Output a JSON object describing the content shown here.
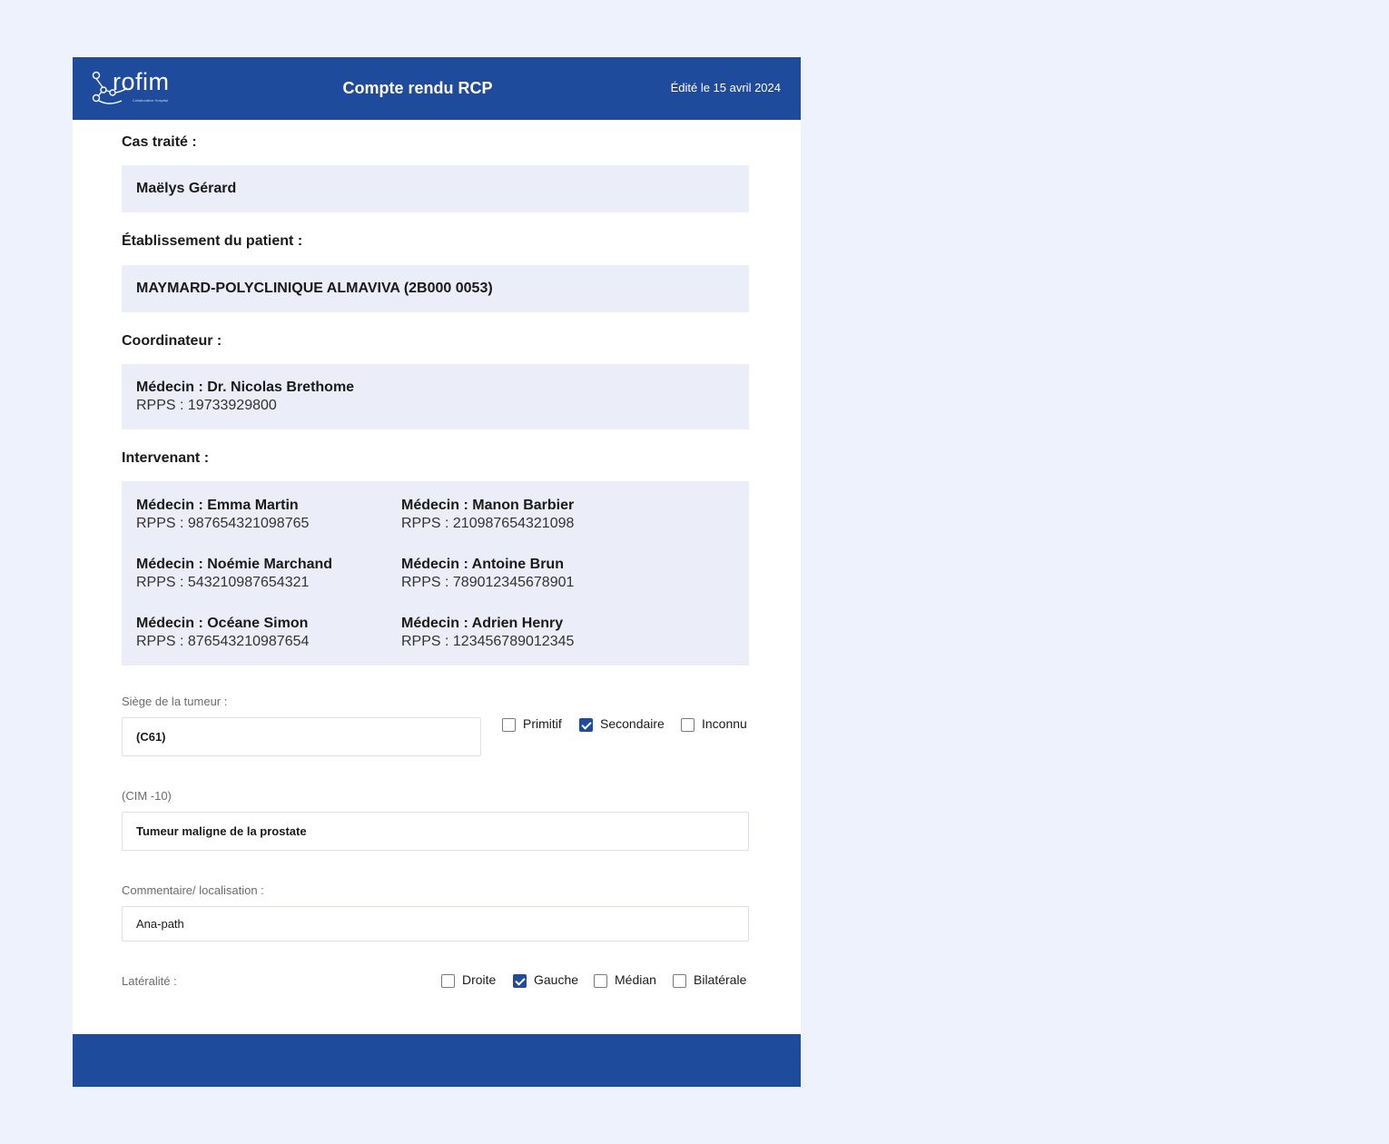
{
  "header": {
    "logo_text": "rofim",
    "logo_subtext": "Collaborative Hospital",
    "title": "Compte rendu RCP",
    "date": "Édité le 15 avril 2024"
  },
  "case": {
    "label": "Cas traité :",
    "value": "Maëlys Gérard"
  },
  "establishment": {
    "label": "Établissement du patient :",
    "value": "MAYMARD-POLYCLINIQUE ALMAVIVA (2B000 0053)"
  },
  "coordinator": {
    "label": "Coordinateur :",
    "doctor": "Médecin : Dr. Nicolas Brethome",
    "rpps": "RPPS : 19733929800"
  },
  "intervenants": {
    "label": "Intervenant :",
    "items": [
      {
        "doctor": "Médecin : Emma Martin",
        "rpps": "RPPS : 987654321098765"
      },
      {
        "doctor": "Médecin : Manon Barbier",
        "rpps": "RPPS : 210987654321098"
      },
      {
        "doctor": "Médecin : Noémie Marchand",
        "rpps": "RPPS : 543210987654321"
      },
      {
        "doctor": "Médecin : Antoine Brun",
        "rpps": "RPPS : 789012345678901"
      },
      {
        "doctor": "Médecin : Océane Simon",
        "rpps": "RPPS : 876543210987654"
      },
      {
        "doctor": "Médecin : Adrien Henry",
        "rpps": "RPPS : 123456789012345"
      }
    ]
  },
  "tumor_site": {
    "label": "Siège de la tumeur :",
    "value": "(C61)",
    "options": [
      {
        "label": "Primitif",
        "checked": false
      },
      {
        "label": "Secondaire",
        "checked": true
      },
      {
        "label": "Inconnu",
        "checked": false
      }
    ]
  },
  "cim10": {
    "label": "(CIM -10)",
    "value": "Tumeur maligne de la prostate"
  },
  "comment": {
    "label": "Commentaire/ localisation :",
    "value": "Ana-path"
  },
  "laterality": {
    "label": "Latéralité :",
    "options": [
      {
        "label": "Droite",
        "checked": false
      },
      {
        "label": "Gauche",
        "checked": true
      },
      {
        "label": "Médian",
        "checked": false
      },
      {
        "label": "Bilatérale",
        "checked": false
      }
    ]
  },
  "colors": {
    "brand": "#1e4b9b",
    "panel": "#ebedf8",
    "background": "#eef2fc"
  }
}
